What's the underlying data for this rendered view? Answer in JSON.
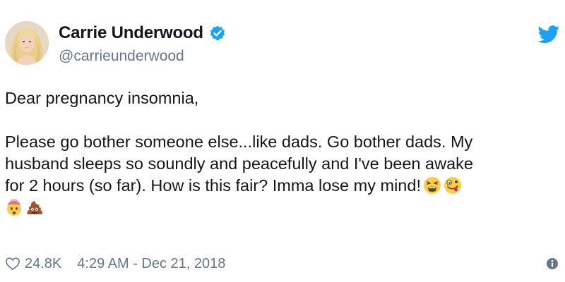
{
  "tweet": {
    "author": {
      "display_name": "Carrie Underwood",
      "handle": "@carrieunderwood",
      "verified": true,
      "avatar_icon": "avatar-photo"
    },
    "body": {
      "paragraph_1": "Dear pregnancy insomnia,",
      "paragraph_2_line_1": "Please go bother someone else...like dads. Go bother dads. My",
      "paragraph_2_line_2": "husband sleeps so soundly and peacefully and I've been awake",
      "paragraph_2_line_3": "for 2 hours (so far). How is this fair? Imma lose my mind!",
      "emojis_line_3": [
        "weary-face-emoji",
        "zany-face-emoji"
      ],
      "emojis_line_4": [
        "exploding-head-emoji",
        "pile-of-poo-emoji"
      ]
    },
    "footer": {
      "likes": "24.8K",
      "timestamp": "4:29 AM - Dec 21, 2018"
    }
  },
  "icons": {
    "brand": "twitter-bird-icon",
    "verified": "verified-badge-icon",
    "like": "heart-icon",
    "info": "info-icon"
  },
  "colors": {
    "brand_blue": "#1da1f2",
    "text_primary": "#14171a",
    "text_secondary": "#657786"
  }
}
